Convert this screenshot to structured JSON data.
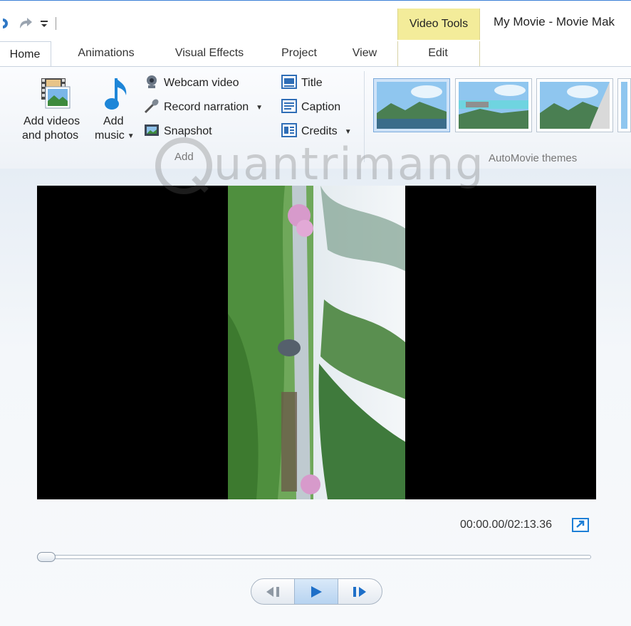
{
  "window": {
    "title": "My Movie - Movie Mak",
    "contextual_tab_group": "Video Tools"
  },
  "tabs": [
    {
      "label": "Home",
      "active": true
    },
    {
      "label": "Animations",
      "active": false
    },
    {
      "label": "Visual Effects",
      "active": false
    },
    {
      "label": "Project",
      "active": false
    },
    {
      "label": "View",
      "active": false
    },
    {
      "label": "Edit",
      "active": false
    }
  ],
  "ribbon": {
    "add_group": {
      "label": "Add",
      "add_videos_label_1": "Add videos",
      "add_videos_label_2": "and photos",
      "add_music_label_1": "Add",
      "add_music_label_2": "music",
      "webcam_video": "Webcam video",
      "record_narration": "Record narration",
      "snapshot": "Snapshot",
      "title": "Title",
      "caption": "Caption",
      "credits": "Credits"
    },
    "themes_group": {
      "label": "AutoMovie themes"
    }
  },
  "preview": {
    "timecode": "00:00.00/02:13.36",
    "seek_progress": 0.0
  },
  "watermark": {
    "text": "uantrimang"
  },
  "colors": {
    "accent": "#3b7fd6",
    "video_tools": "#f3ec9a",
    "player_bg": "#000000"
  }
}
